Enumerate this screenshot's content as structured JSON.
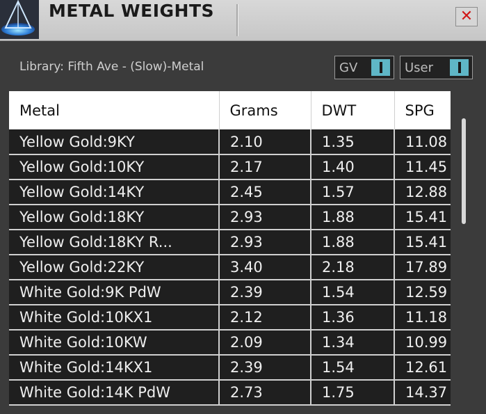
{
  "window": {
    "title": "METAL WEIGHTS"
  },
  "library": {
    "label": "Library: Fifth Ave - (Slow)-Metal"
  },
  "toggles": [
    {
      "label": "GV"
    },
    {
      "label": "User"
    }
  ],
  "table": {
    "columns": [
      "Metal",
      "Grams",
      "DWT",
      "SPG"
    ],
    "rows": [
      [
        "Yellow Gold:9KY",
        "2.10",
        "1.35",
        "11.08"
      ],
      [
        "Yellow Gold:10KY",
        "2.17",
        "1.40",
        "11.45"
      ],
      [
        "Yellow Gold:14KY",
        "2.45",
        "1.57",
        "12.88"
      ],
      [
        "Yellow Gold:18KY",
        "2.93",
        "1.88",
        "15.41"
      ],
      [
        "Yellow Gold:18KY R...",
        "2.93",
        "1.88",
        "15.41"
      ],
      [
        "Yellow Gold:22KY",
        "3.40",
        "2.18",
        "17.89"
      ],
      [
        "White Gold:9K PdW",
        "2.39",
        "1.54",
        "12.59"
      ],
      [
        "White Gold:10KX1",
        "2.12",
        "1.36",
        "11.18"
      ],
      [
        "White Gold:10KW",
        "2.09",
        "1.34",
        "10.99"
      ],
      [
        "White Gold:14KX1",
        "2.39",
        "1.54",
        "12.61"
      ],
      [
        "White Gold:14K PdW",
        "2.73",
        "1.75",
        "14.37"
      ]
    ]
  },
  "colors": {
    "toggle_accent": "#5fb6c6",
    "close_x": "#d01818"
  }
}
